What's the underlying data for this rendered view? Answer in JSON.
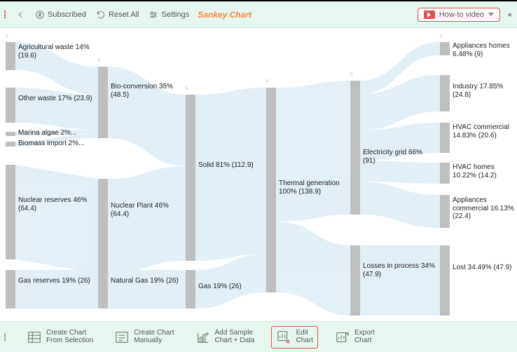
{
  "toolbar": {
    "subscribed": "Subscribed",
    "reset": "Reset All",
    "settings": "Settings",
    "title": "Sankey Chart",
    "howto": "How-to video"
  },
  "bottom": {
    "create_selection_l1": "Create Chart",
    "create_selection_l2": "From Selection",
    "create_manual_l1": "Create Chart",
    "create_manual_l2": "Manually",
    "add_sample_l1": "Add Sample",
    "add_sample_l2": "Chart + Data",
    "edit_l1": "Edit",
    "edit_l2": "Chart",
    "export_l1": "Export",
    "export_l2": "Chart"
  },
  "chart_data": {
    "type": "sankey",
    "total": 138.9,
    "columns": [
      [
        {
          "id": "agri",
          "label": "Agricultural waste 14% (19.6)",
          "pct": 14,
          "value": 19.6
        },
        {
          "id": "other",
          "label": "Other waste 17% (23.9)",
          "pct": 17,
          "value": 23.9
        },
        {
          "id": "algae",
          "label": "Marina algae 2%...",
          "pct": 2,
          "value": 2.8
        },
        {
          "id": "bioimp",
          "label": "Biomass import 2%...",
          "pct": 2,
          "value": 2.8
        },
        {
          "id": "nucres",
          "label": "Nuclear reserves 46% (64.4)",
          "pct": 46,
          "value": 64.4
        },
        {
          "id": "gasres",
          "label": "Gas reserves 19% (26)",
          "pct": 19,
          "value": 26
        }
      ],
      [
        {
          "id": "bio",
          "label": "Bio-conversion 35% (48.5)",
          "pct": 35,
          "value": 48.5
        },
        {
          "id": "nucplant",
          "label": "Nuclear Plant 46% (64.4)",
          "pct": 46,
          "value": 64.4
        },
        {
          "id": "natgas",
          "label": "Natural Gas 19% (26)",
          "pct": 19,
          "value": 26
        }
      ],
      [
        {
          "id": "solid",
          "label": "Solid 81% (112.9)",
          "pct": 81,
          "value": 112.9
        },
        {
          "id": "gas",
          "label": "Gas 19% (26)",
          "pct": 19,
          "value": 26
        }
      ],
      [
        {
          "id": "thermal",
          "label": "Thermal generation 100% (138.9)",
          "pct": 100,
          "value": 138.9
        }
      ],
      [
        {
          "id": "grid",
          "label": "Electricity grid 66% (91)",
          "pct": 66,
          "value": 91
        },
        {
          "id": "loss",
          "label": "Losses in process 34% (47.9)",
          "pct": 34,
          "value": 47.9
        }
      ],
      [
        {
          "id": "apphome",
          "label": "Appliances homes 6.48% (9)",
          "pct": 6.48,
          "value": 9
        },
        {
          "id": "ind",
          "label": "Industry 17.85% (24.8)",
          "pct": 17.85,
          "value": 24.8
        },
        {
          "id": "hvacc",
          "label": "HVAC commercial 14.83% (20.6)",
          "pct": 14.83,
          "value": 20.6
        },
        {
          "id": "hvach",
          "label": "HVAC homes 10.22% (14.2)",
          "pct": 10.22,
          "value": 14.2
        },
        {
          "id": "appcom",
          "label": "Appliances commercial 16.13% (22.4)",
          "pct": 16.13,
          "value": 22.4
        },
        {
          "id": "lost",
          "label": "Lost 34.49% (47.9)",
          "pct": 34.49,
          "value": 47.9
        }
      ]
    ],
    "links": [
      {
        "from": "agri",
        "to": "bio"
      },
      {
        "from": "other",
        "to": "bio"
      },
      {
        "from": "algae",
        "to": "bio"
      },
      {
        "from": "bioimp",
        "to": "bio"
      },
      {
        "from": "nucres",
        "to": "nucplant"
      },
      {
        "from": "gasres",
        "to": "natgas"
      },
      {
        "from": "bio",
        "to": "solid"
      },
      {
        "from": "nucplant",
        "to": "solid"
      },
      {
        "from": "natgas",
        "to": "gas"
      },
      {
        "from": "solid",
        "to": "thermal"
      },
      {
        "from": "gas",
        "to": "thermal"
      },
      {
        "from": "thermal",
        "to": "grid"
      },
      {
        "from": "thermal",
        "to": "loss"
      },
      {
        "from": "grid",
        "to": "apphome"
      },
      {
        "from": "grid",
        "to": "ind"
      },
      {
        "from": "grid",
        "to": "hvacc"
      },
      {
        "from": "grid",
        "to": "hvach"
      },
      {
        "from": "grid",
        "to": "appcom"
      },
      {
        "from": "loss",
        "to": "lost"
      }
    ]
  }
}
